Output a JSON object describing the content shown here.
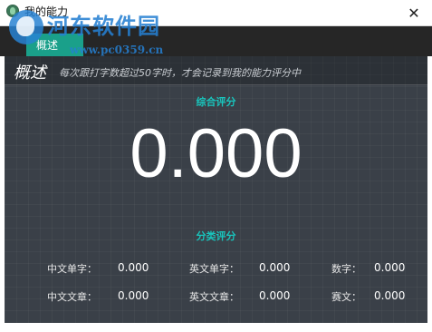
{
  "window": {
    "title": "我的能力",
    "close_glyph": "✕"
  },
  "watermark": {
    "text": "河东软件园",
    "url": "www.pc0359.cn"
  },
  "tabs": [
    {
      "label": "概述"
    }
  ],
  "panel": {
    "title": "概述",
    "subtitle": "每次跟打字数超过50字时，才会记录到我的能力评分中"
  },
  "overall": {
    "title": "综合评分",
    "score": "0.000"
  },
  "categories": {
    "title": "分类评分",
    "items": [
      {
        "label": "中文单字：",
        "value": "0.000"
      },
      {
        "label": "英文单字：",
        "value": "0.000"
      },
      {
        "label": "数字：",
        "value": "0.000"
      },
      {
        "label": "中文文章：",
        "value": "0.000"
      },
      {
        "label": "英文文章：",
        "value": "0.000"
      },
      {
        "label": "赛文：",
        "value": "0.000"
      }
    ]
  },
  "colors": {
    "accent": "#1aa08a",
    "section_title": "#19c5bd",
    "panel_bg": "#3a4048",
    "tabbar_bg": "#262626"
  }
}
